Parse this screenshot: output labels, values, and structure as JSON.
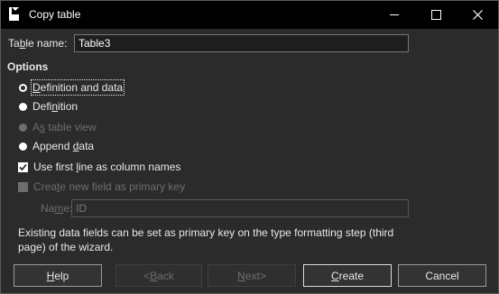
{
  "window": {
    "title": "Copy table",
    "icon": "document-icon",
    "controls": {
      "minimize": "minimize-icon",
      "maximize": "maximize-icon",
      "close": "close-icon"
    }
  },
  "table_name": {
    "label_pre": "Ta",
    "label_mnemonic": "b",
    "label_post": "le name:",
    "value": "Table3"
  },
  "options": {
    "heading": "Options",
    "radios": [
      {
        "pre": "",
        "mnemonic": "D",
        "post": "efinition and data",
        "selected": true,
        "enabled": true
      },
      {
        "pre": "Defi",
        "mnemonic": "n",
        "post": "ition",
        "selected": false,
        "enabled": true
      },
      {
        "pre": "A",
        "mnemonic": "s",
        "post": " table view",
        "selected": false,
        "enabled": false
      },
      {
        "pre": "Append ",
        "mnemonic": "d",
        "post": "ata",
        "selected": false,
        "enabled": true
      }
    ],
    "checkboxes": [
      {
        "pre": "Use first ",
        "mnemonic": "l",
        "post": "ine as column names",
        "checked": true,
        "enabled": true
      },
      {
        "pre": "Crea",
        "mnemonic": "t",
        "post": "e new field as primary key",
        "checked": false,
        "enabled": false
      }
    ]
  },
  "primary_key_name": {
    "label_pre": "Na",
    "label_mnemonic": "m",
    "label_post": "e:",
    "value": "ID"
  },
  "info_text": "Existing data fields can be set as primary key on the type formatting step (third page) of the wizard.",
  "buttons": {
    "help": {
      "pre": "",
      "mnemonic": "H",
      "post": "elp"
    },
    "back": {
      "pre": "< ",
      "mnemonic": "B",
      "post": "ack"
    },
    "next": {
      "pre": "",
      "mnemonic": "N",
      "post": "ext>"
    },
    "create": {
      "pre": "",
      "mnemonic": "C",
      "post": "reate"
    },
    "cancel": {
      "pre": "Cancel",
      "mnemonic": "",
      "post": ""
    }
  },
  "colors": {
    "background": "#2b2b2b",
    "titlebar": "#000000",
    "text": "#e8e8e8",
    "disabled_text": "#6e6e6e"
  }
}
